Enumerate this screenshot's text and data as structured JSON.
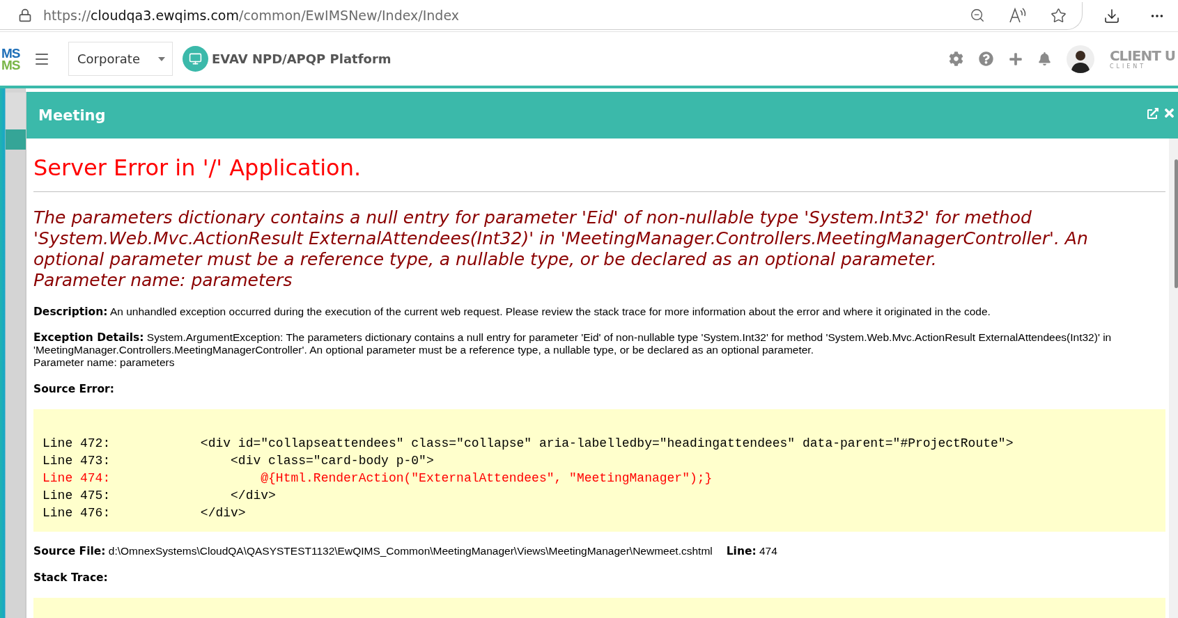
{
  "browser": {
    "url": {
      "scheme": "https://",
      "host": "cloudqa3.ewqims.com",
      "path": "/common/EwIMSNew/Index/Index"
    }
  },
  "header": {
    "logo": [
      "MS",
      "MS"
    ],
    "org_select": {
      "value": "Corporate"
    },
    "platform_title": "EVAV NPD/APQP Platform",
    "user": {
      "name": "CLIENT U",
      "role": "CLIENT"
    }
  },
  "modal": {
    "title": "Meeting",
    "error": {
      "title": "Server Error in '/' Application.",
      "message_lines": [
        "The parameters dictionary contains a null entry for parameter 'Eid' of non-nullable type 'System.Int32' for method",
        "'System.Web.Mvc.ActionResult ExternalAttendees(Int32)' in 'MeetingManager.Controllers.MeetingManagerController'. An",
        "optional parameter must be a reference type, a nullable type, or be declared as an optional parameter.",
        "Parameter name: parameters"
      ],
      "description": "**Description:** An unhandled exception occurred during the execution of the current web request. Please review the stack trace for more information about the error and where it originated in the code.",
      "exception_lines": [
        "**Exception Details:** System.ArgumentException: The parameters dictionary contains a null entry for parameter 'Eid' of non-nullable type 'System.Int32' for method 'System.Web.Mvc.ActionResult ExternalAttendees(Int32)' in",
        "'MeetingManager.Controllers.MeetingManagerController'. An optional parameter must be a reference type, a nullable type, or be declared as an optional parameter.",
        "Parameter name: parameters"
      ],
      "source_error_label": "Source Error:",
      "code_lines": [
        {
          "text": "Line 472:            <div id=\"collapseattendees\" class=\"collapse\" aria-labelledby=\"headingattendees\" data-parent=\"#ProjectRoute\">",
          "highlighted": false
        },
        {
          "text": "Line 473:                <div class=\"card-body p-0\">",
          "highlighted": false
        },
        {
          "text": "Line 474:                    @{Html.RenderAction(\"ExternalAttendees\", \"MeetingManager\");}",
          "highlighted": true
        },
        {
          "text": "Line 475:                </div>",
          "highlighted": false
        },
        {
          "text": "Line 476:            </div>",
          "highlighted": false
        }
      ],
      "source_file": "**Source File:** d:\\OmnexSystems\\CloudQA\\QASYSTEST1132\\EwQIMS_Common\\MeetingManager\\Views\\MeetingManager\\Newmeet.cshtml",
      "source_line": "**Line:** 474",
      "stack_trace_label": "Stack Trace:"
    }
  }
}
